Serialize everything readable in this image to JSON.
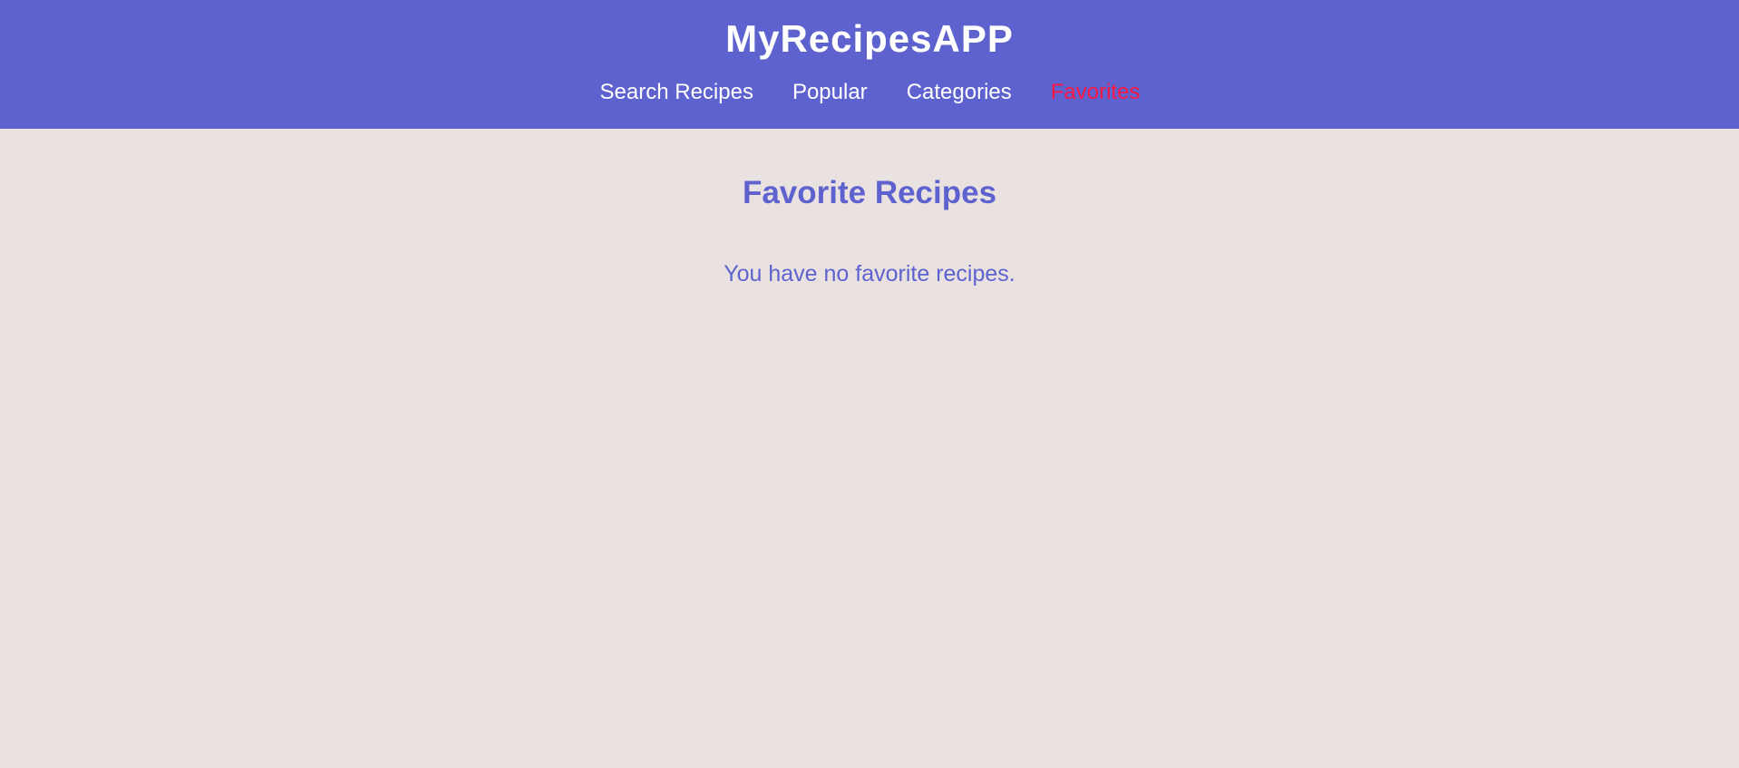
{
  "header": {
    "app_title": "MyRecipesAPP",
    "nav": [
      {
        "label": "Search Recipes",
        "active": false
      },
      {
        "label": "Popular",
        "active": false
      },
      {
        "label": "Categories",
        "active": false
      },
      {
        "label": "Favorites",
        "active": true
      }
    ]
  },
  "main": {
    "page_title": "Favorite Recipes",
    "empty_message": "You have no favorite recipes."
  },
  "colors": {
    "header_bg": "#5e62cf",
    "page_bg": "#eae2e0",
    "accent": "#5e62cf",
    "active_nav": "#ff1744"
  }
}
